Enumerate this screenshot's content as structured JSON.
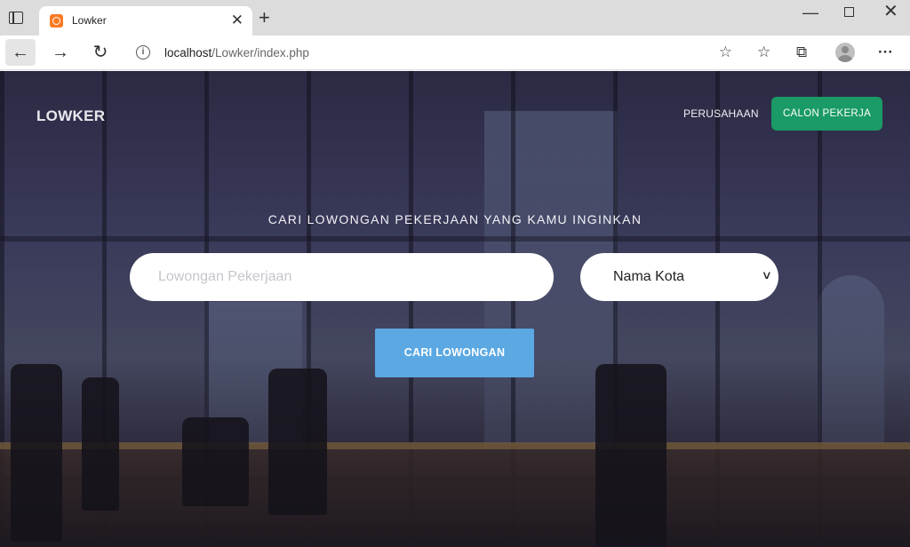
{
  "browser": {
    "tab_title": "Lowker",
    "url_host": "localhost",
    "url_path": "/Lowker/index.php",
    "icons": [
      "tab-actions-icon",
      "xampp-favicon",
      "close-icon",
      "plus-icon",
      "back-icon",
      "forward-icon",
      "reload-icon",
      "info-icon",
      "add-favorite-icon",
      "favorites-icon",
      "collections-icon",
      "profile-icon",
      "more-icon"
    ]
  },
  "site": {
    "brand": "LOWKER",
    "nav_company": "PERUSAHAAN",
    "nav_candidate": "CALON PEKERJA",
    "headline": "CARI LOWONGAN PEKERJAAN YANG KAMU INGINKAN",
    "search_placeholder": "Lowongan Pekerjaan",
    "search_value": "",
    "city_selected": "Nama Kota",
    "search_button": "CARI LOWONGAN"
  },
  "colors": {
    "cta_green": "#1a9a66",
    "search_blue": "#5ba8e3",
    "overlay_navy": "#2b2a44"
  }
}
